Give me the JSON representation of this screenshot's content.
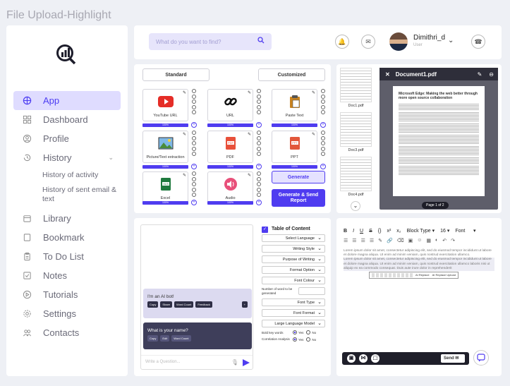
{
  "app_title": "File Upload-Highlight",
  "sidebar": {
    "items": [
      {
        "label": "App",
        "icon": "globe-icon"
      },
      {
        "label": "Dashboard",
        "icon": "grid-icon"
      },
      {
        "label": "Profile",
        "icon": "user-circle-icon"
      },
      {
        "label": "History",
        "icon": "history-icon"
      },
      {
        "label": "History of activity"
      },
      {
        "label": "History of sent email & text"
      },
      {
        "label": "Library",
        "icon": "library-icon"
      },
      {
        "label": "Bookmark",
        "icon": "bookmark-icon"
      },
      {
        "label": "To Do List",
        "icon": "clipboard-icon"
      },
      {
        "label": "Notes",
        "icon": "notes-icon"
      },
      {
        "label": "Tutorials",
        "icon": "play-circle-icon"
      },
      {
        "label": "Settings",
        "icon": "gear-icon"
      },
      {
        "label": "Contacts",
        "icon": "contacts-icon"
      }
    ]
  },
  "topbar": {
    "search_placeholder": "What do you want to find?",
    "user_name": "Dimithri_d",
    "user_role": "User"
  },
  "generator": {
    "tab_standard": "Standard",
    "tab_customized": "Customized",
    "cards": [
      {
        "label": "YouTube URL",
        "progress": "100%"
      },
      {
        "label": "URL",
        "progress": "100%"
      },
      {
        "label": "Paste Text",
        "progress": "100%"
      },
      {
        "label": "Picture/Text extraction",
        "progress": "100%"
      },
      {
        "label": "PDF",
        "progress": "100%"
      },
      {
        "label": "PPT",
        "progress": "100%"
      },
      {
        "label": "Excel",
        "progress": "100%"
      },
      {
        "label": "Audio",
        "progress": "100%"
      }
    ],
    "generate_label": "Generate",
    "generate_report_label": "Generate & Send Report"
  },
  "pdf_viewer": {
    "docs": [
      "Doc1.pdf",
      "Doc3.pdf",
      "Doc4.pdf"
    ],
    "open_doc": "Document1.pdf",
    "page_title": "Microsoft Edge: Making the web better through more open source collaboration",
    "page_indicator": "Page 1 of 2"
  },
  "chat": {
    "bot_message": "I'm an AI bot!",
    "bot_actions": [
      "Copy",
      "Share",
      "Word Count",
      "Feedback"
    ],
    "user_message": "What is your name?",
    "user_actions": [
      "Copy",
      "Edit",
      "Word Count"
    ],
    "input_placeholder": "Write a Question..."
  },
  "toc": {
    "title": "Table of Content",
    "dropdowns": [
      "Select Language",
      "Writing Style",
      "Purpose of Writing",
      "Format Option",
      "Font Colour"
    ],
    "words_label": "Number of word to be generated",
    "dropdowns2": [
      "Font Type",
      "Font Format",
      "Large Language Model"
    ],
    "bold_label": "Bold key words",
    "corr_label": "Correlation Analysis",
    "yes": "Yes",
    "no": "No"
  },
  "editor": {
    "block_type": "Block Type",
    "font_size": "16",
    "font": "Font",
    "para1": "Lorem ipsum dolor sit amet, consectetur adipiscing elit, sed do eiusmod tempor incididunt ut labore et dolore magna aliqua. Ut enim ad minim veniam, quis nostrud exercitation ullamco.",
    "para2": "Lorem ipsum dolor sit amet, consectetur adipiscing elit, sed do eiusmod tempor incididunt ut labore et dolore magna aliqua. Ut enim ad minim veniam, quis nostrud exercitation ullamco laboris nisi ut aliquip ex ea commodo consequat. Duis aute irure dolor in reprehenderit",
    "ai_replace": "AI Replace",
    "ai_replace_upload": "AI Replace Upload",
    "send_label": "Send"
  }
}
